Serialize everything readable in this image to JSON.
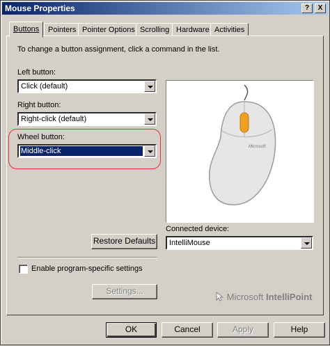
{
  "window": {
    "title": "Mouse Properties",
    "help_button": "?",
    "close_button": "X"
  },
  "tabs": [
    {
      "label": "Buttons",
      "active": true
    },
    {
      "label": "Pointers",
      "active": false
    },
    {
      "label": "Pointer Options",
      "active": false
    },
    {
      "label": "Scrolling",
      "active": false
    },
    {
      "label": "Hardware",
      "active": false
    },
    {
      "label": "Activities",
      "active": false
    }
  ],
  "buttons_tab": {
    "instruction": "To change a button assignment, click a command in the list.",
    "left_button": {
      "label": "Left button:",
      "value": "Click (default)"
    },
    "right_button": {
      "label": "Right button:",
      "value": "Right-click (default)"
    },
    "wheel_button": {
      "label": "Wheel button:",
      "value": "Middle-click"
    },
    "restore_defaults": "Restore Defaults",
    "connected_device": {
      "label": "Connected device:",
      "value": "IntelliMouse"
    },
    "program_specific": {
      "label": "Enable program-specific settings",
      "checked": false
    },
    "settings_button": "Settings...",
    "brand": {
      "prefix": "Microsoft",
      "name": "IntelliPoint"
    },
    "mouse_logo": "Microsoft"
  },
  "footer": {
    "ok": "OK",
    "cancel": "Cancel",
    "apply": "Apply",
    "help": "Help"
  },
  "colors": {
    "title_gradient_start": "#0a246a",
    "selection": "#0a246a",
    "highlight_ring": "#dd3333",
    "wheel_accent": "#f0a020",
    "face": "#d4d0c8"
  }
}
